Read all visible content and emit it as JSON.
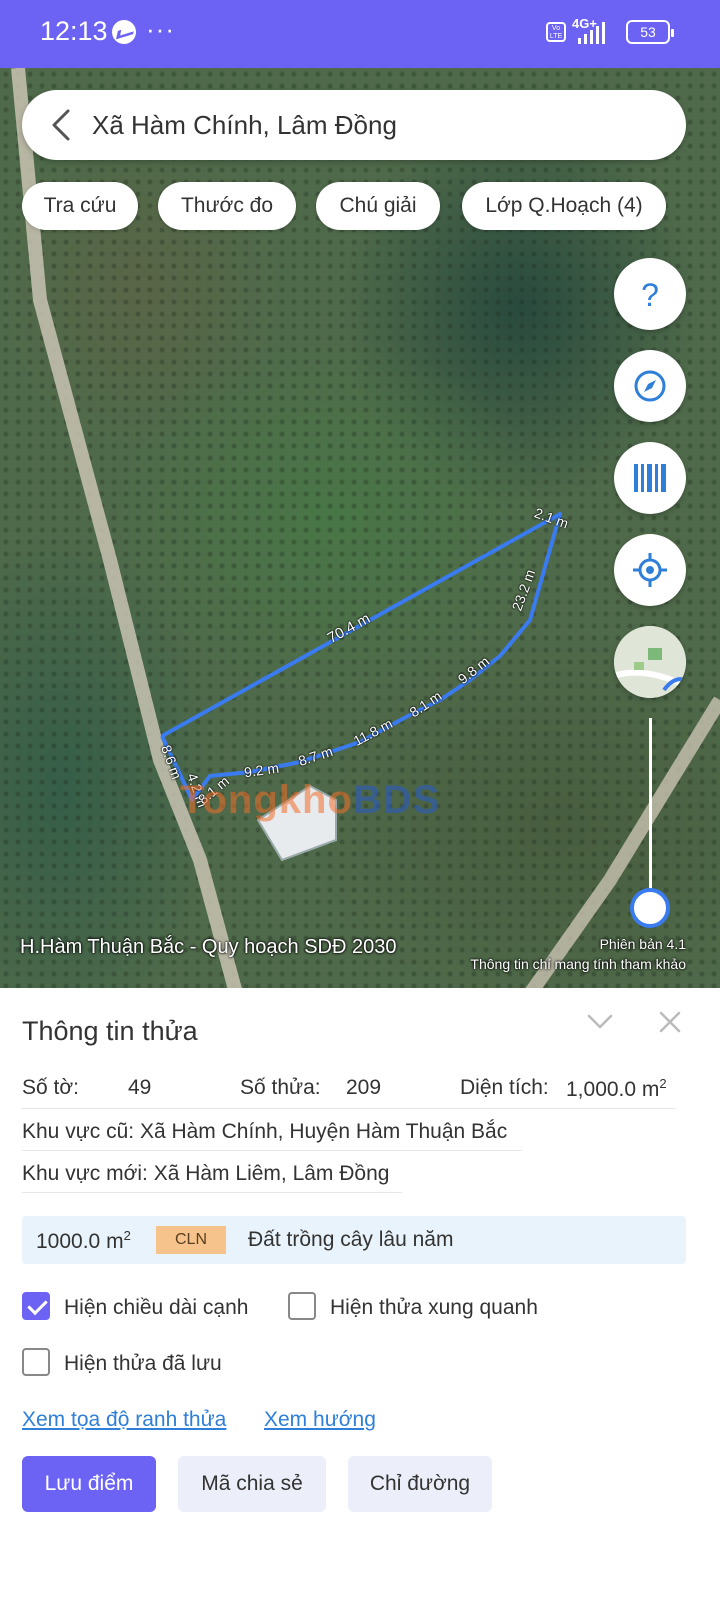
{
  "status_bar": {
    "time": "12:13",
    "more": "···",
    "network": "4G+",
    "volte": "Vo LTE",
    "battery": "53"
  },
  "search": {
    "title": "Xã Hàm Chính, Lâm Đồng"
  },
  "chips": [
    {
      "label": "Tra cứu"
    },
    {
      "label": "Thước đo"
    },
    {
      "label": "Chú giải"
    },
    {
      "label": "Lớp Q.Hoạch (4)"
    }
  ],
  "map": {
    "edge_labels": [
      "2.1 m",
      "23.2 m",
      "70.4 m",
      "9.8 m",
      "8.1 m",
      "11.8 m",
      "8.7 m",
      "9.2 m",
      "8.6 m",
      "4.2 m",
      "8.1 m"
    ],
    "watermark_prefix": "Tongkho",
    "watermark_suffix": "BDS",
    "bottom_left_label": "H.Hàm Thuận Bắc - Quy hoạch SDĐ 2030",
    "version_label": "Phiên bản 4.1",
    "disclaimer": "Thông tin chỉ mang tính tham khảo"
  },
  "panel": {
    "title": "Thông tin thửa",
    "so_to_label": "Số tờ:",
    "so_to_value": "49",
    "so_thua_label": "Số thửa:",
    "so_thua_value": "209",
    "dien_tich_label": "Diện tích:",
    "dien_tich_value": "1,000.0 m",
    "area_sup": "2",
    "khu_vuc_cu": "Khu vực cũ: Xã Hàm Chính, Huyện Hàm Thuận Bắc",
    "khu_vuc_moi": "Khu vực mới: Xã Hàm Liêm, Lâm Đồng",
    "land_area": "1000.0 m",
    "land_code": "CLN",
    "land_desc": "Đất trồng cây lâu năm",
    "checkboxes": [
      {
        "label": "Hiện chiều dài cạnh",
        "checked": true
      },
      {
        "label": "Hiện thửa xung quanh",
        "checked": false
      },
      {
        "label": "Hiện thửa đã lưu",
        "checked": false
      }
    ],
    "links": [
      {
        "label": "Xem tọa độ ranh thửa"
      },
      {
        "label": "Xem hướng"
      }
    ],
    "buttons": {
      "save": "Lưu điểm",
      "share": "Mã chia sẻ",
      "directions": "Chỉ đường"
    }
  },
  "colors": {
    "accent": "#6c63f4",
    "link": "#2f7fd8",
    "parcel_line": "#3a7bf0",
    "land_code_bg": "#f6c38c"
  }
}
